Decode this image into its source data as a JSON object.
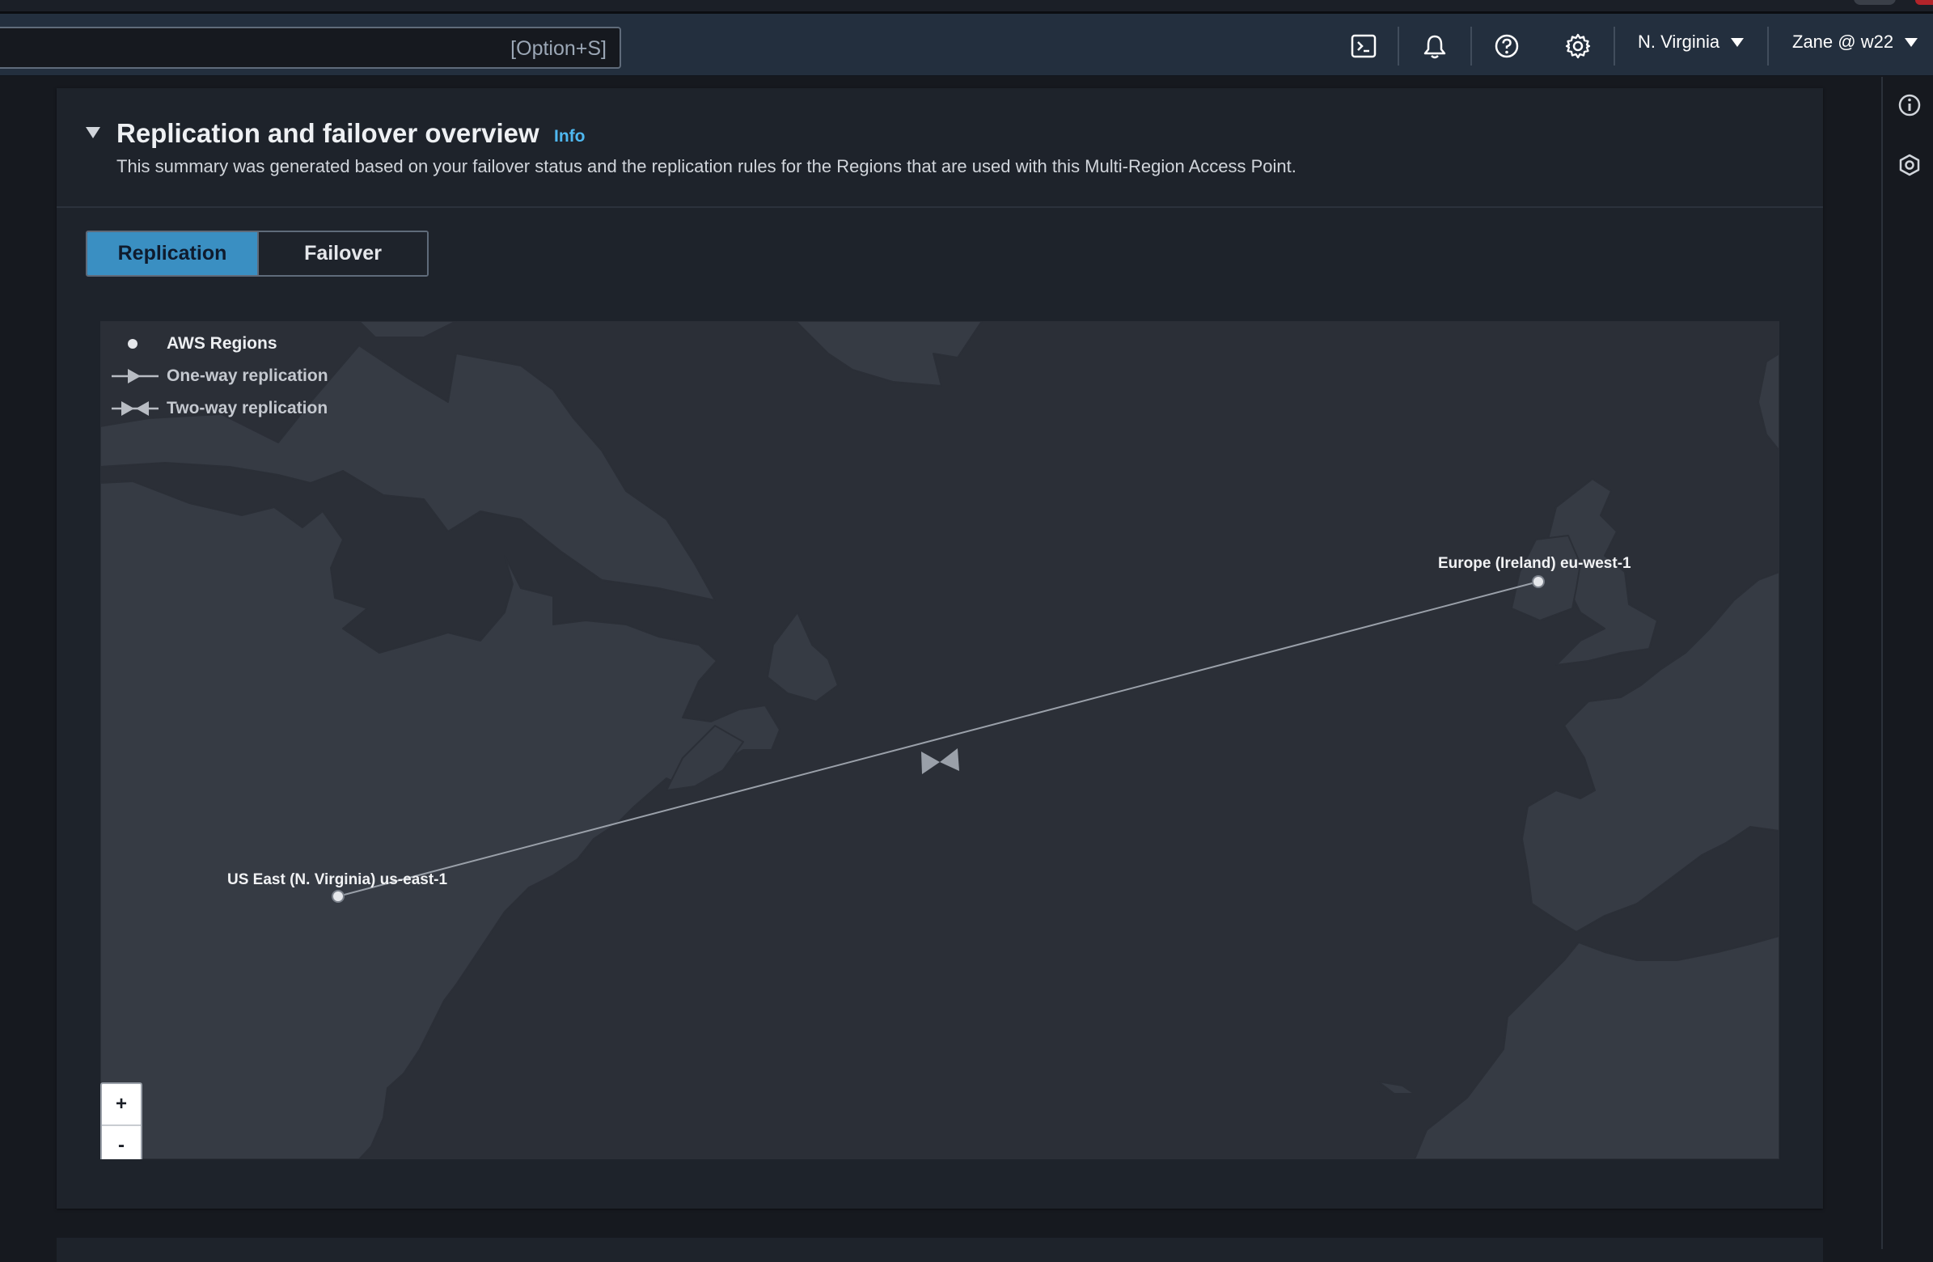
{
  "topnav": {
    "search": {
      "value": "",
      "placeholder": "",
      "shortcut": "[Option+S]"
    },
    "icons": [
      "cloudshell-icon",
      "bell-icon",
      "help-icon",
      "gear-icon"
    ],
    "region": "N. Virginia",
    "account": "Zane @ w22"
  },
  "panel": {
    "title": "Replication and failover overview",
    "info": "Info",
    "description": "This summary was generated based on your failover status and the replication rules for the Regions that are used with this Multi-Region Access Point.",
    "tabs": [
      {
        "label": "Replication",
        "selected": true
      },
      {
        "label": "Failover",
        "selected": false
      }
    ]
  },
  "map": {
    "legend": {
      "regions": "AWS Regions",
      "one_way": "One-way replication",
      "two_way": "Two-way replication"
    },
    "regions": [
      {
        "label": "US East (N. Virginia) us-east-1"
      },
      {
        "label": "Europe (Ireland) eu-west-1"
      }
    ],
    "replication": "two-way",
    "zoom_in": "+",
    "zoom_out": "-"
  },
  "colors": {
    "accent": "#3a8fc2",
    "info_link": "#4fb8f0",
    "nav_bg": "#232f3e",
    "land": "#363b44",
    "water": "#2b2f37"
  }
}
